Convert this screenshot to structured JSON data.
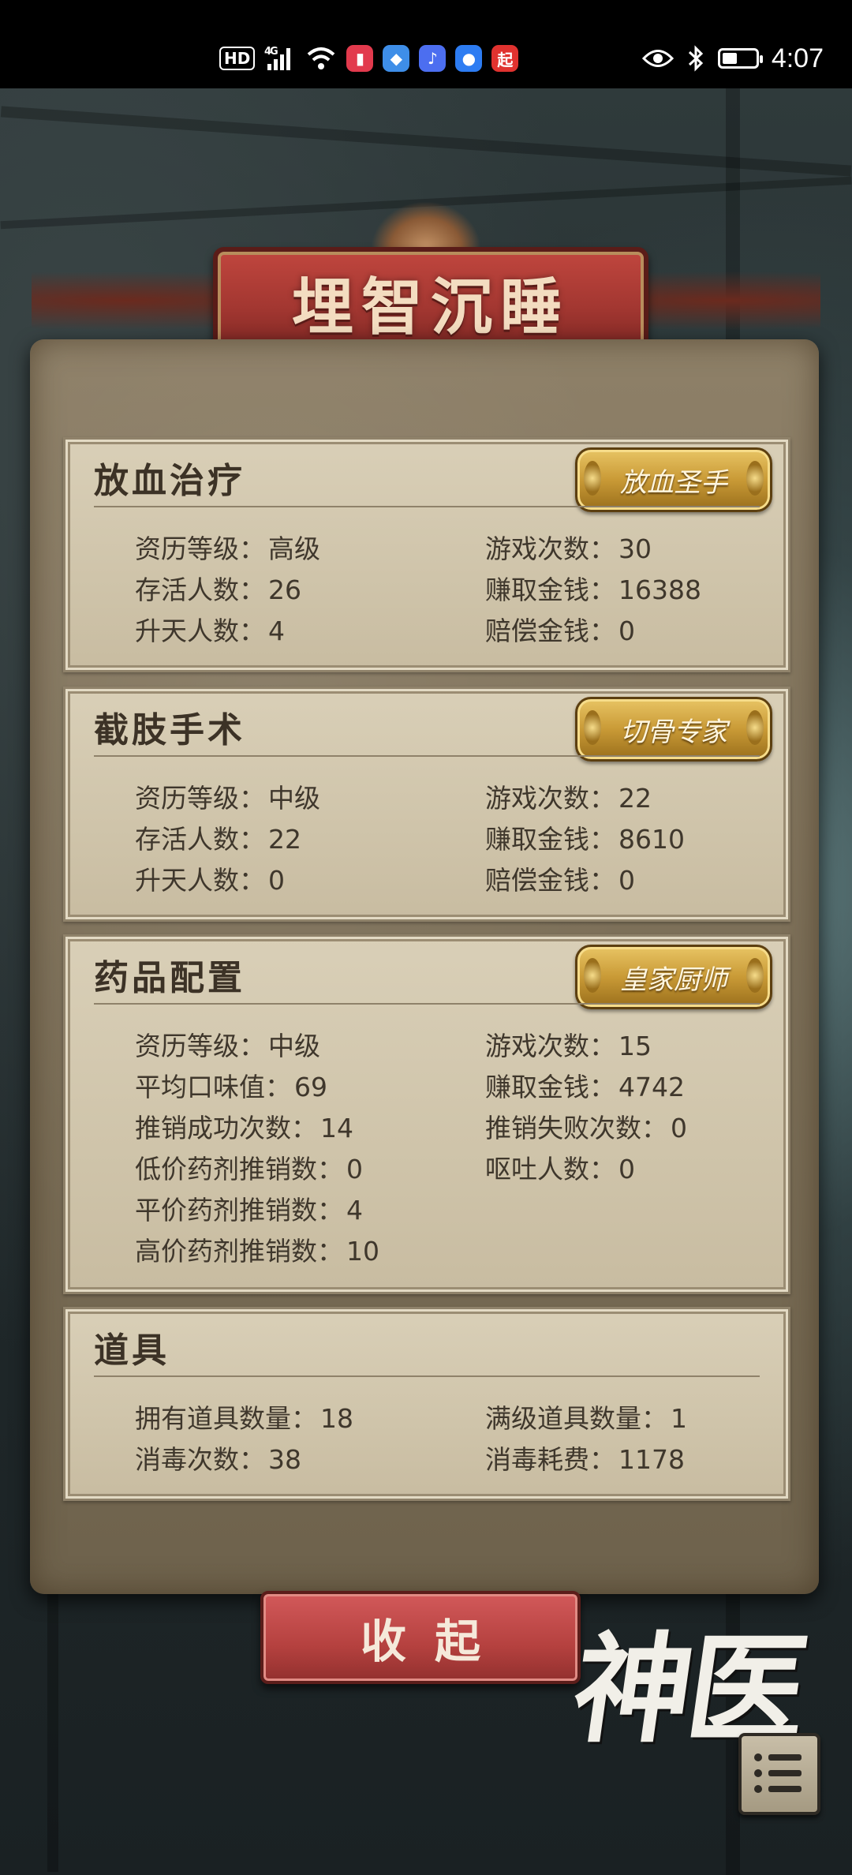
{
  "status_bar": {
    "hd": "HD",
    "network": "4G",
    "app_icon_last": "起",
    "time": "4:07",
    "battery_level": 0.45
  },
  "title": "埋智沉睡",
  "sections": [
    {
      "title": "放血治疗",
      "badge": "放血圣手",
      "left": [
        {
          "label": "资历等级：",
          "value": "高级"
        },
        {
          "label": "存活人数：",
          "value": "26"
        },
        {
          "label": "升天人数：",
          "value": "4"
        }
      ],
      "right": [
        {
          "label": "游戏次数：",
          "value": "30"
        },
        {
          "label": "赚取金钱：",
          "value": "16388"
        },
        {
          "label": "赔偿金钱：",
          "value": "0"
        }
      ]
    },
    {
      "title": "截肢手术",
      "badge": "切骨专家",
      "left": [
        {
          "label": "资历等级：",
          "value": "中级"
        },
        {
          "label": "存活人数：",
          "value": "22"
        },
        {
          "label": "升天人数：",
          "value": "0"
        }
      ],
      "right": [
        {
          "label": "游戏次数：",
          "value": "22"
        },
        {
          "label": "赚取金钱：",
          "value": "8610"
        },
        {
          "label": "赔偿金钱：",
          "value": "0"
        }
      ]
    },
    {
      "title": "药品配置",
      "badge": "皇家厨师",
      "left": [
        {
          "label": "资历等级：",
          "value": "中级"
        },
        {
          "label": "平均口味值：",
          "value": "69"
        },
        {
          "label": "推销成功次数：",
          "value": "14"
        },
        {
          "label": "低价药剂推销数：",
          "value": "0"
        },
        {
          "label": "平价药剂推销数：",
          "value": "4"
        },
        {
          "label": "高价药剂推销数：",
          "value": "10"
        }
      ],
      "right": [
        {
          "label": "游戏次数：",
          "value": "15"
        },
        {
          "label": "赚取金钱：",
          "value": "4742"
        },
        {
          "label": "推销失败次数：",
          "value": "0"
        },
        {
          "label": "呕吐人数：",
          "value": "0"
        }
      ]
    },
    {
      "title": "道具",
      "left": [
        {
          "label": "拥有道具数量：",
          "value": "18"
        },
        {
          "label": "消毒次数：",
          "value": "38"
        }
      ],
      "right": [
        {
          "label": "满级道具数量：",
          "value": "1"
        },
        {
          "label": "消毒耗费：",
          "value": "1178"
        }
      ]
    }
  ],
  "collapse_button": "收起",
  "logo_text": "神医",
  "icons": [
    "eye-icon",
    "bluetooth-icon",
    "battery-icon",
    "wifi-icon",
    "signal-icon",
    "menu-list-icon"
  ]
}
